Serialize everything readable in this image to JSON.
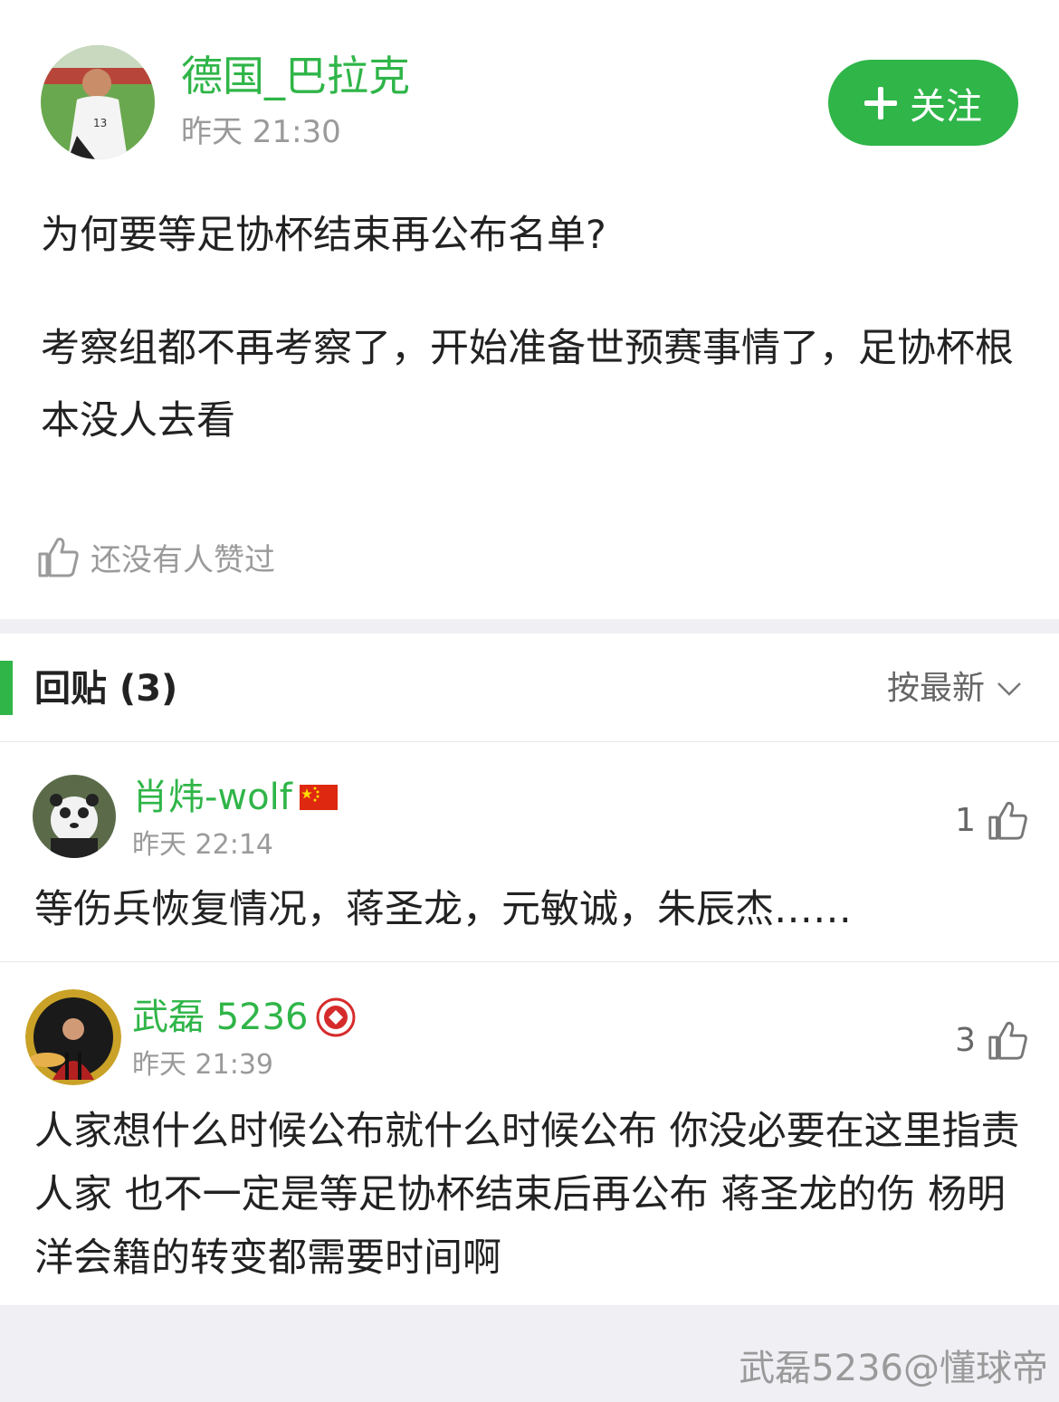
{
  "post": {
    "author": "德国_巴拉克",
    "time": "昨天 21:30",
    "follow_label": "关注",
    "title": "为何要等足协杯结束再公布名单?",
    "body": "考察组都不再考察了，开始准备世预赛事情了，足协杯根本没人去看",
    "likes_text": "还没有人赞过",
    "accent_color": "#2fb548"
  },
  "replies": {
    "title": "回贴 (3)",
    "sort_label": "按最新",
    "items": [
      {
        "author": "肖炜-wolf",
        "time": "昨天 22:14",
        "likes": "1",
        "text": "等伤兵恢复情况，蒋圣龙，元敏诚，朱辰杰……",
        "badge": "china-flag-icon"
      },
      {
        "author": "武磊 5236",
        "time": "昨天 21:39",
        "likes": "3",
        "text": "人家想什么时候公布就什么时候公布 你没必要在这里指责人家 也不一定是等足协杯结束后再公布 蒋圣龙的伤 杨明洋会籍的转变都需要时间啊",
        "badge": "club-crest-icon"
      }
    ]
  },
  "watermark": "武磊5236@懂球帝"
}
